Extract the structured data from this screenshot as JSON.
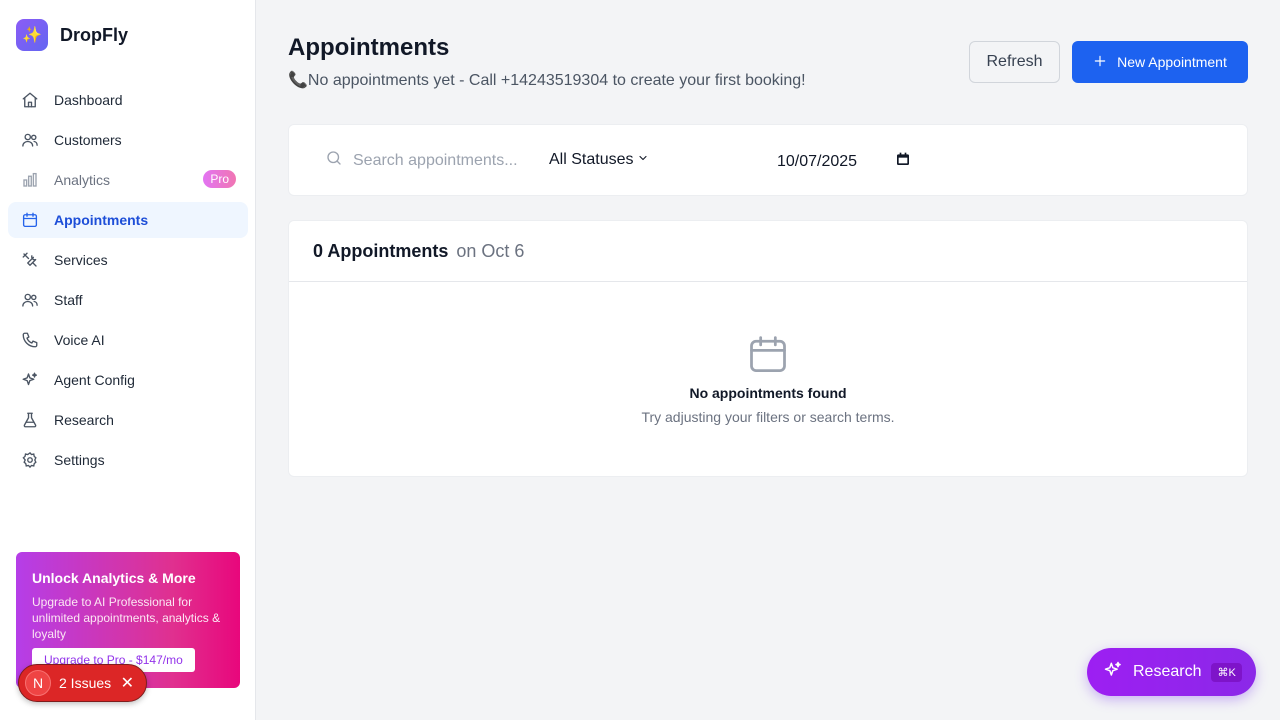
{
  "brand": {
    "logo_glyph": "✨",
    "name": "DropFly"
  },
  "nav": [
    {
      "label": "Dashboard",
      "icon": "home-icon"
    },
    {
      "label": "Customers",
      "icon": "users-icon"
    },
    {
      "label": "Analytics",
      "icon": "bar-chart-icon",
      "badge": "Pro"
    },
    {
      "label": "Appointments",
      "icon": "calendar-icon",
      "active": true
    },
    {
      "label": "Services",
      "icon": "tools-icon"
    },
    {
      "label": "Staff",
      "icon": "staff-icon"
    },
    {
      "label": "Voice AI",
      "icon": "phone-icon"
    },
    {
      "label": "Agent Config",
      "icon": "sparkles-icon"
    },
    {
      "label": "Research",
      "icon": "flask-icon"
    },
    {
      "label": "Settings",
      "icon": "gear-icon"
    }
  ],
  "upgrade": {
    "title": "Unlock Analytics & More",
    "text": "Upgrade to AI Professional for unlimited appointments, analytics & loyalty",
    "button": "Upgrade to Pro - $147/mo"
  },
  "issues": {
    "avatar": "N",
    "label": "2 Issues",
    "close": "✕"
  },
  "header": {
    "title": "Appointments",
    "subtitle": "📞No appointments yet - Call +14243519304 to create your first booking!",
    "refresh": "Refresh",
    "new_button": "New Appointment"
  },
  "filters": {
    "search_placeholder": "Search appointments...",
    "status": "All Statuses",
    "date": "10/07/2025"
  },
  "results": {
    "count": "0 Appointments",
    "date_label": "on Oct 6",
    "empty_title": "No appointments found",
    "empty_text": "Try adjusting your filters or search terms."
  },
  "research_fab": {
    "label": "Research",
    "shortcut": "⌘K"
  },
  "colors": {
    "primary": "#1d62f0",
    "research": "#9b23f0",
    "issues": "#dc2626"
  }
}
